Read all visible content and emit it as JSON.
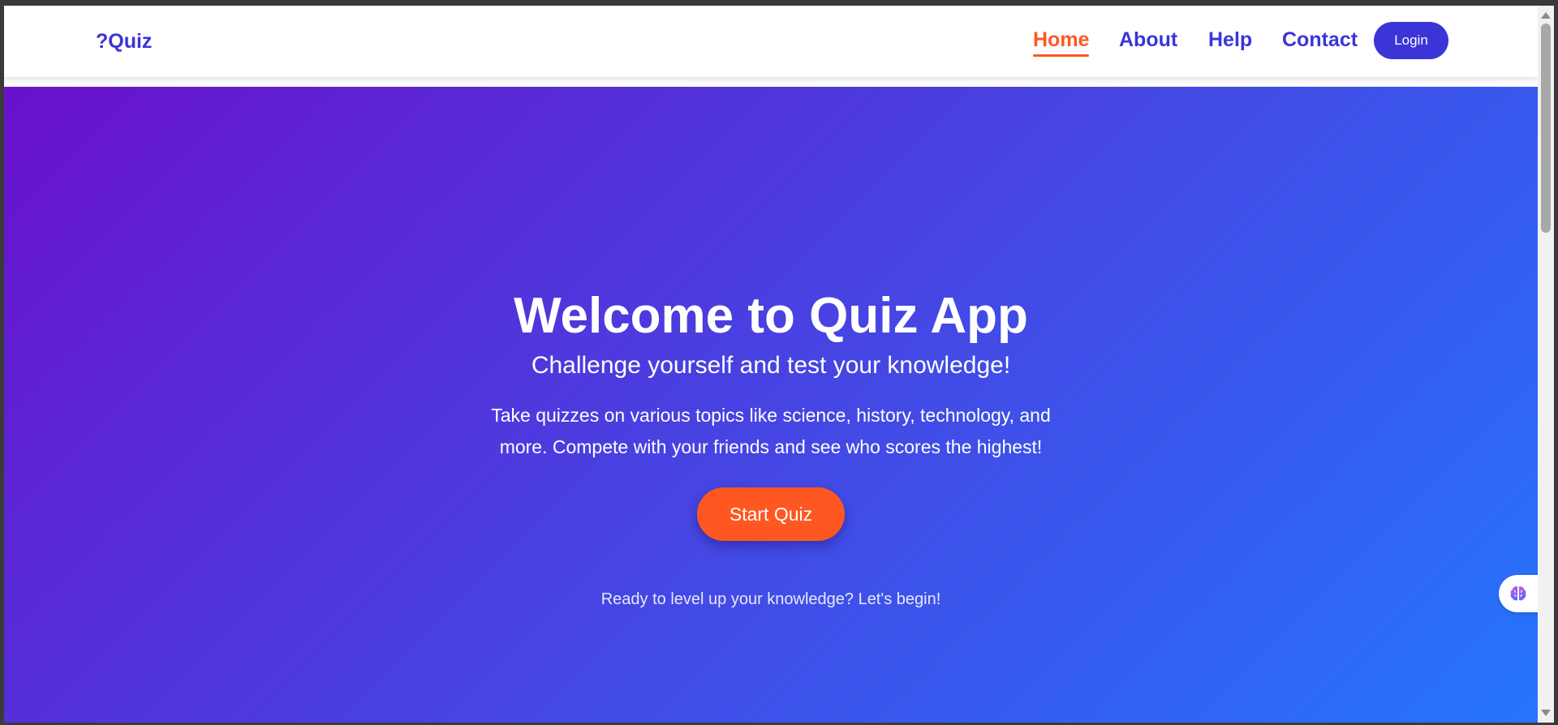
{
  "navbar": {
    "logo": "?Quiz",
    "links": [
      {
        "label": "Home",
        "active": true
      },
      {
        "label": "About",
        "active": false
      },
      {
        "label": "Help",
        "active": false
      },
      {
        "label": "Contact",
        "active": false
      }
    ],
    "login_label": "Login"
  },
  "hero": {
    "title": "Welcome to Quiz App",
    "subtitle": "Challenge yourself and test your knowledge!",
    "description": "Take quizzes on various topics like science, history, technology, and more. Compete with your friends and see who scores the highest!",
    "cta_label": "Start Quiz",
    "footer_text": "Ready to level up your knowledge? Let's begin!"
  },
  "widget": {
    "icon": "brain-icon"
  },
  "colors": {
    "brand": "#3b35d8",
    "accent": "#ff5722",
    "gradient_start": "#6a11cb",
    "gradient_end": "#2575fc"
  }
}
